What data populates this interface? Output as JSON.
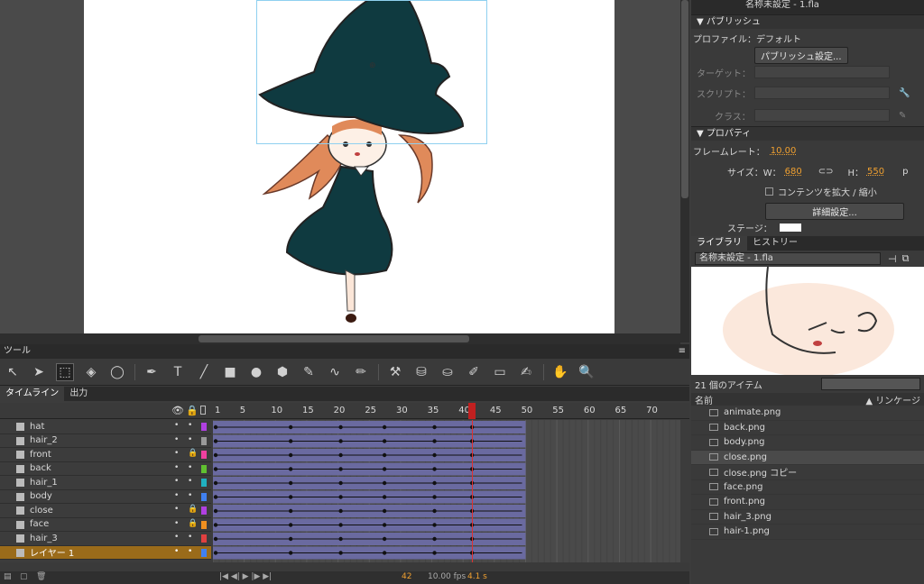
{
  "window_title": "名称未設定 - 1.fla",
  "panels": {
    "tools_tab": "ツール",
    "timeline_tab": "タイムライン",
    "output_tab": "出力"
  },
  "tools": [
    "selection-tool",
    "subselection-tool",
    "free-transform-tool",
    "3d-rotation-tool",
    "lasso-tool",
    "pen-tool",
    "text-tool",
    "line-tool",
    "rectangle-tool",
    "oval-tool",
    "polystar-tool",
    "pencil-tool",
    "brush-tool",
    "paintbrush-tool",
    "bone-tool",
    "paint-bucket-tool",
    "ink-bottle-tool",
    "eyedropper-tool",
    "eraser-tool",
    "width-tool",
    "hand-tool",
    "zoom-tool"
  ],
  "tools_glyphs": [
    "↖",
    "➤",
    "⬚",
    "◈",
    "◯",
    "✒",
    "T",
    "╱",
    "■",
    "●",
    "⬢",
    "✎",
    "∿",
    "✏",
    "⚒",
    "⛁",
    "⛀",
    "✐",
    "▭",
    "✍",
    "✋",
    "🔍"
  ],
  "timeline": {
    "ruler": [
      "1",
      "5",
      "10",
      "15",
      "20",
      "25",
      "30",
      "35",
      "40",
      "45",
      "50",
      "55",
      "60",
      "65",
      "70"
    ],
    "current_frame": "42",
    "fps": "10.00 fps",
    "time": "4.1 s",
    "layers": [
      {
        "name": "hat",
        "locked": false,
        "color": "#b040e0"
      },
      {
        "name": "hair_2",
        "locked": false,
        "color": "#999999"
      },
      {
        "name": "front",
        "locked": true,
        "color": "#f040a0"
      },
      {
        "name": "back",
        "locked": false,
        "color": "#60c030"
      },
      {
        "name": "hair_1",
        "locked": false,
        "color": "#20b0c0"
      },
      {
        "name": "body",
        "locked": false,
        "color": "#4080f0"
      },
      {
        "name": "close",
        "locked": true,
        "color": "#b040e0"
      },
      {
        "name": "face",
        "locked": true,
        "color": "#f09020"
      },
      {
        "name": "hair_3",
        "locked": false,
        "color": "#e04040"
      },
      {
        "name": "レイヤー 1",
        "locked": false,
        "color": "#4080f0"
      }
    ]
  },
  "publish": {
    "header": "パブリッシュ",
    "profile_label": "プロファイル：デフォルト",
    "settings_button": "パブリッシュ設定...",
    "target_label": "ターゲット：",
    "script_label": "スクリプト：",
    "class_label": "クラス："
  },
  "properties": {
    "header": "プロパティ",
    "fps_label": "フレームレート：",
    "fps_value": "10.00",
    "size_label": "サイズ：",
    "w_label": "W：",
    "w_value": "680",
    "h_label": "H：",
    "h_value": "550",
    "unit": "p",
    "scale_label": "コンテンツを拡大 / 縮小",
    "advanced_button": "詳細設定...",
    "stage_label": "ステージ："
  },
  "library": {
    "tab_library": "ライブラリ",
    "tab_history": "ヒストリー",
    "doc_select": "名称未設定 - 1.fla",
    "item_count": "21 個のアイテム",
    "col_name": "名前",
    "col_linkage": "リンケージ",
    "items": [
      "animate.png",
      "back.png",
      "body.png",
      "close.png",
      "close.png コピー",
      "face.png",
      "front.png",
      "hair_3.png",
      "hair-1.png"
    ]
  }
}
